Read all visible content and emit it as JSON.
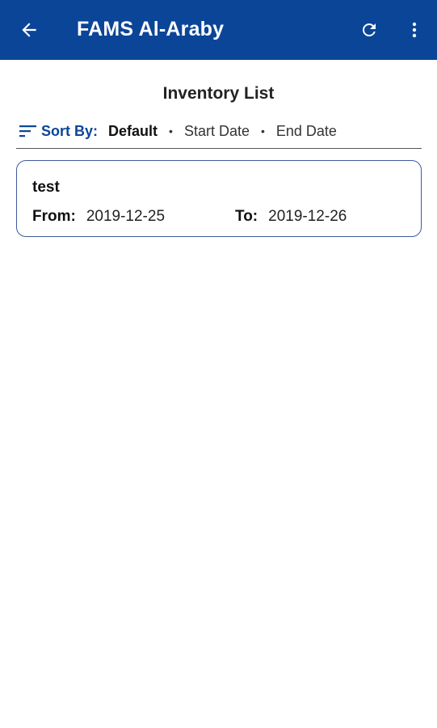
{
  "app_bar": {
    "title": "FAMS Al-Araby",
    "back_icon": "arrow-back-icon",
    "refresh_icon": "refresh-icon",
    "more_icon": "more-vert-icon",
    "background_color": "#0b4597"
  },
  "page": {
    "title": "Inventory List"
  },
  "sort": {
    "icon": "sort-icon",
    "label": "Sort By:",
    "options": [
      "Default",
      "Start Date",
      "End Date"
    ],
    "selected": "Default",
    "separator": "•"
  },
  "inventories": [
    {
      "name": "test",
      "from_label": "From:",
      "from_date": "2019-12-25",
      "to_label": "To:",
      "to_date": "2019-12-26"
    }
  ]
}
